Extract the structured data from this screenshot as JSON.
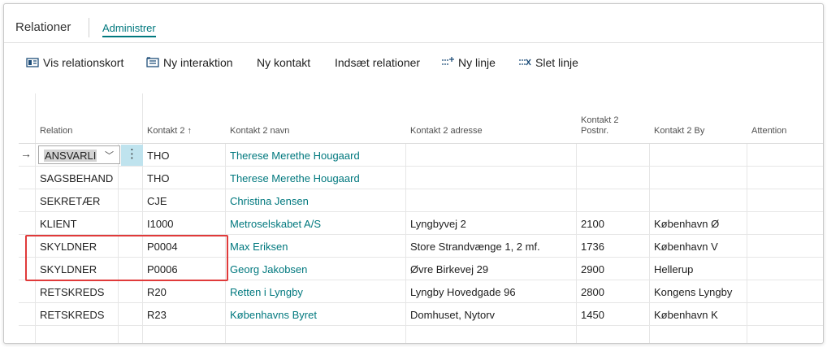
{
  "tabs": {
    "title": "Relationer",
    "admin": "Administrer"
  },
  "toolbar": {
    "vis_relationskort": "Vis relationskort",
    "ny_interaktion": "Ny interaktion",
    "ny_kontakt": "Ny kontakt",
    "indsaet_relationer": "Indsæt relationer",
    "ny_linje": "Ny linje",
    "slet_linje": "Slet linje"
  },
  "columns": {
    "relation": "Relation",
    "kontakt2": "Kontakt 2",
    "sort_arrow": "↑",
    "kontakt2_navn": "Kontakt 2 navn",
    "kontakt2_adresse": "Kontakt 2 adresse",
    "kontakt2_postnr_1": "Kontakt 2",
    "kontakt2_postnr_2": "Postnr.",
    "kontakt2_by": "Kontakt 2 By",
    "attention": "Attention"
  },
  "rows": [
    {
      "relation": "ANSVARLI",
      "kontakt": "THO",
      "navn": "Therese Merethe Hougaard",
      "adresse": "",
      "postnr": "",
      "by": ""
    },
    {
      "relation": "SAGSBEHAND",
      "kontakt": "THO",
      "navn": "Therese Merethe Hougaard",
      "adresse": "",
      "postnr": "",
      "by": ""
    },
    {
      "relation": "SEKRETÆR",
      "kontakt": "CJE",
      "navn": "Christina Jensen",
      "adresse": "",
      "postnr": "",
      "by": ""
    },
    {
      "relation": "KLIENT",
      "kontakt": "I1000",
      "navn": "Metroselskabet A/S",
      "adresse": "Lyngbyvej 2",
      "postnr": "2100",
      "by": "København Ø"
    },
    {
      "relation": "SKYLDNER",
      "kontakt": "P0004",
      "navn": "Max Eriksen",
      "adresse": "Store Strandvænge 1, 2 mf.",
      "postnr": "1736",
      "by": "København V"
    },
    {
      "relation": "SKYLDNER",
      "kontakt": "P0006",
      "navn": "Georg Jakobsen",
      "adresse": "Øvre Birkevej 29",
      "postnr": "2900",
      "by": "Hellerup"
    },
    {
      "relation": "RETSKREDS",
      "kontakt": "R20",
      "navn": "Retten i Lyngby",
      "adresse": "Lyngby Hovedgade 96",
      "postnr": "2800",
      "by": "Kongens Lyngby"
    },
    {
      "relation": "RETSKREDS",
      "kontakt": "R23",
      "navn": "Københavns Byret",
      "adresse": "Domhuset, Nytorv",
      "postnr": "1450",
      "by": "København K"
    }
  ],
  "colors": {
    "link": "#00787e",
    "highlight": "#e03a3a",
    "selected_action": "#bfe3ee"
  }
}
